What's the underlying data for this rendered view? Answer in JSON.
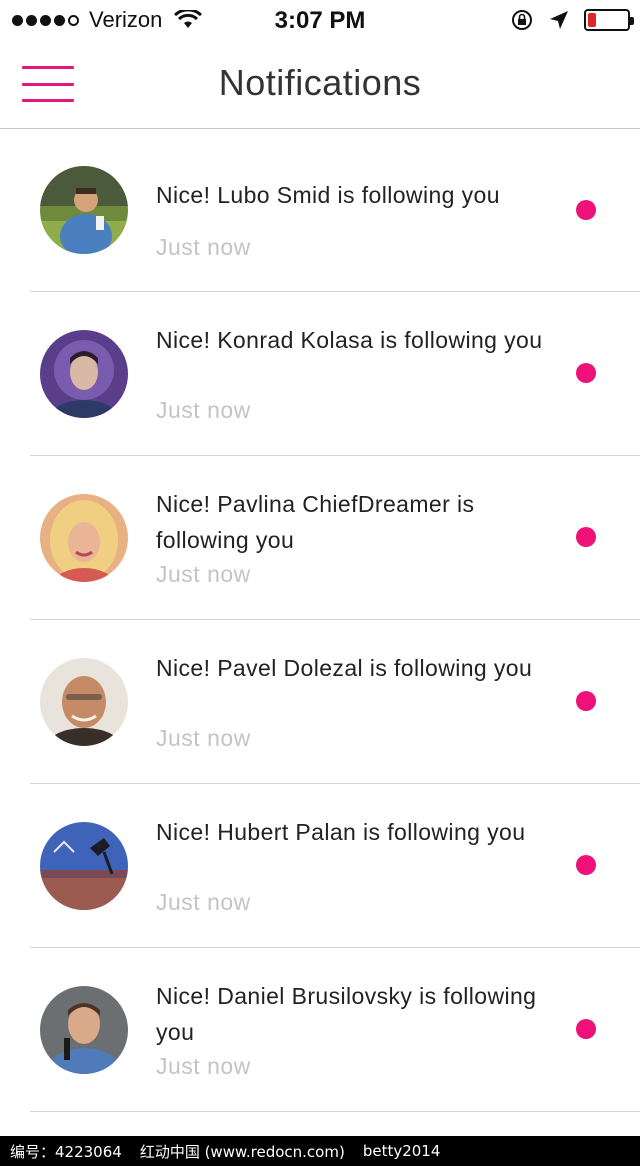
{
  "status_bar": {
    "carrier": "Verizon",
    "time": "3:07 PM",
    "signal_icon": "signal-dots-icon",
    "wifi_icon": "wifi-icon",
    "lock_icon": "rotation-lock-icon",
    "location_icon": "location-arrow-icon",
    "battery_icon": "battery-icon",
    "battery_level": 0.2,
    "battery_color": "#e0262d"
  },
  "header": {
    "title": "Notifications",
    "menu_icon": "hamburger-menu-icon",
    "accent_color": "#e0197d"
  },
  "notifications": [
    {
      "message": "Nice! Lubo Smid is following you",
      "time": "Just now",
      "unread": true
    },
    {
      "message": "Nice! Konrad Kolasa is following you",
      "time": "Just now",
      "unread": true
    },
    {
      "message": "Nice! Pavlina ChiefDreamer is following you",
      "time": "Just now",
      "unread": true
    },
    {
      "message": "Nice! Pavel Dolezal is following you",
      "time": "Just now",
      "unread": true
    },
    {
      "message": "Nice! Hubert Palan is following you",
      "time": "Just now",
      "unread": true
    },
    {
      "message": "Nice! Daniel Brusilovsky is following you",
      "time": "Just now",
      "unread": true
    }
  ],
  "unread_color": "#ee1278",
  "footer": {
    "id_text": "编号：4223064",
    "site_text": "红动中国 (www.redocn.com)",
    "author": "betty2014"
  }
}
